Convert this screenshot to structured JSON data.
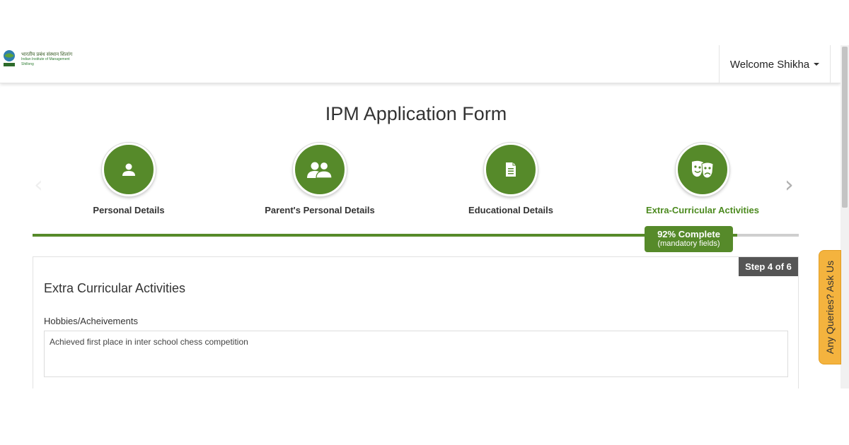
{
  "header": {
    "logo": {
      "icon": "iim-shillong-emblem",
      "line1": "भारतीय प्रबंध संस्थान शिलांग",
      "line2": "Indian Institute of Management",
      "line3": "Shillong"
    },
    "welcome": "Welcome Shikha"
  },
  "page": {
    "title": "IPM Application Form"
  },
  "steps": [
    {
      "label": "Personal Details",
      "icon": "person-icon",
      "active": false
    },
    {
      "label": "Parent's Personal Details",
      "icon": "parents-icon",
      "active": false
    },
    {
      "label": "Educational Details",
      "icon": "document-icon",
      "active": false
    },
    {
      "label": "Extra-Curricular Activities",
      "icon": "theater-masks-icon",
      "active": true
    }
  ],
  "carousel": {
    "prev_icon": "chevron-left-icon",
    "next_icon": "chevron-right-icon"
  },
  "progress": {
    "percent": 92,
    "label": "92% Complete",
    "sublabel": "(mandatory fields)"
  },
  "form": {
    "step_tag": "Step 4 of 6",
    "section_title": "Extra Curricular Activities",
    "hobbies_label": "Hobbies/Acheivements",
    "hobbies_value": "Achieved first place in inter school chess competition"
  },
  "side_tab": {
    "label": "Any Queries? Ask Us"
  },
  "colors": {
    "accent_green": "#568a2a",
    "active_label": "#4c8a1f",
    "query_tab": "#f4b33e",
    "step_tag_bg": "#555555"
  }
}
